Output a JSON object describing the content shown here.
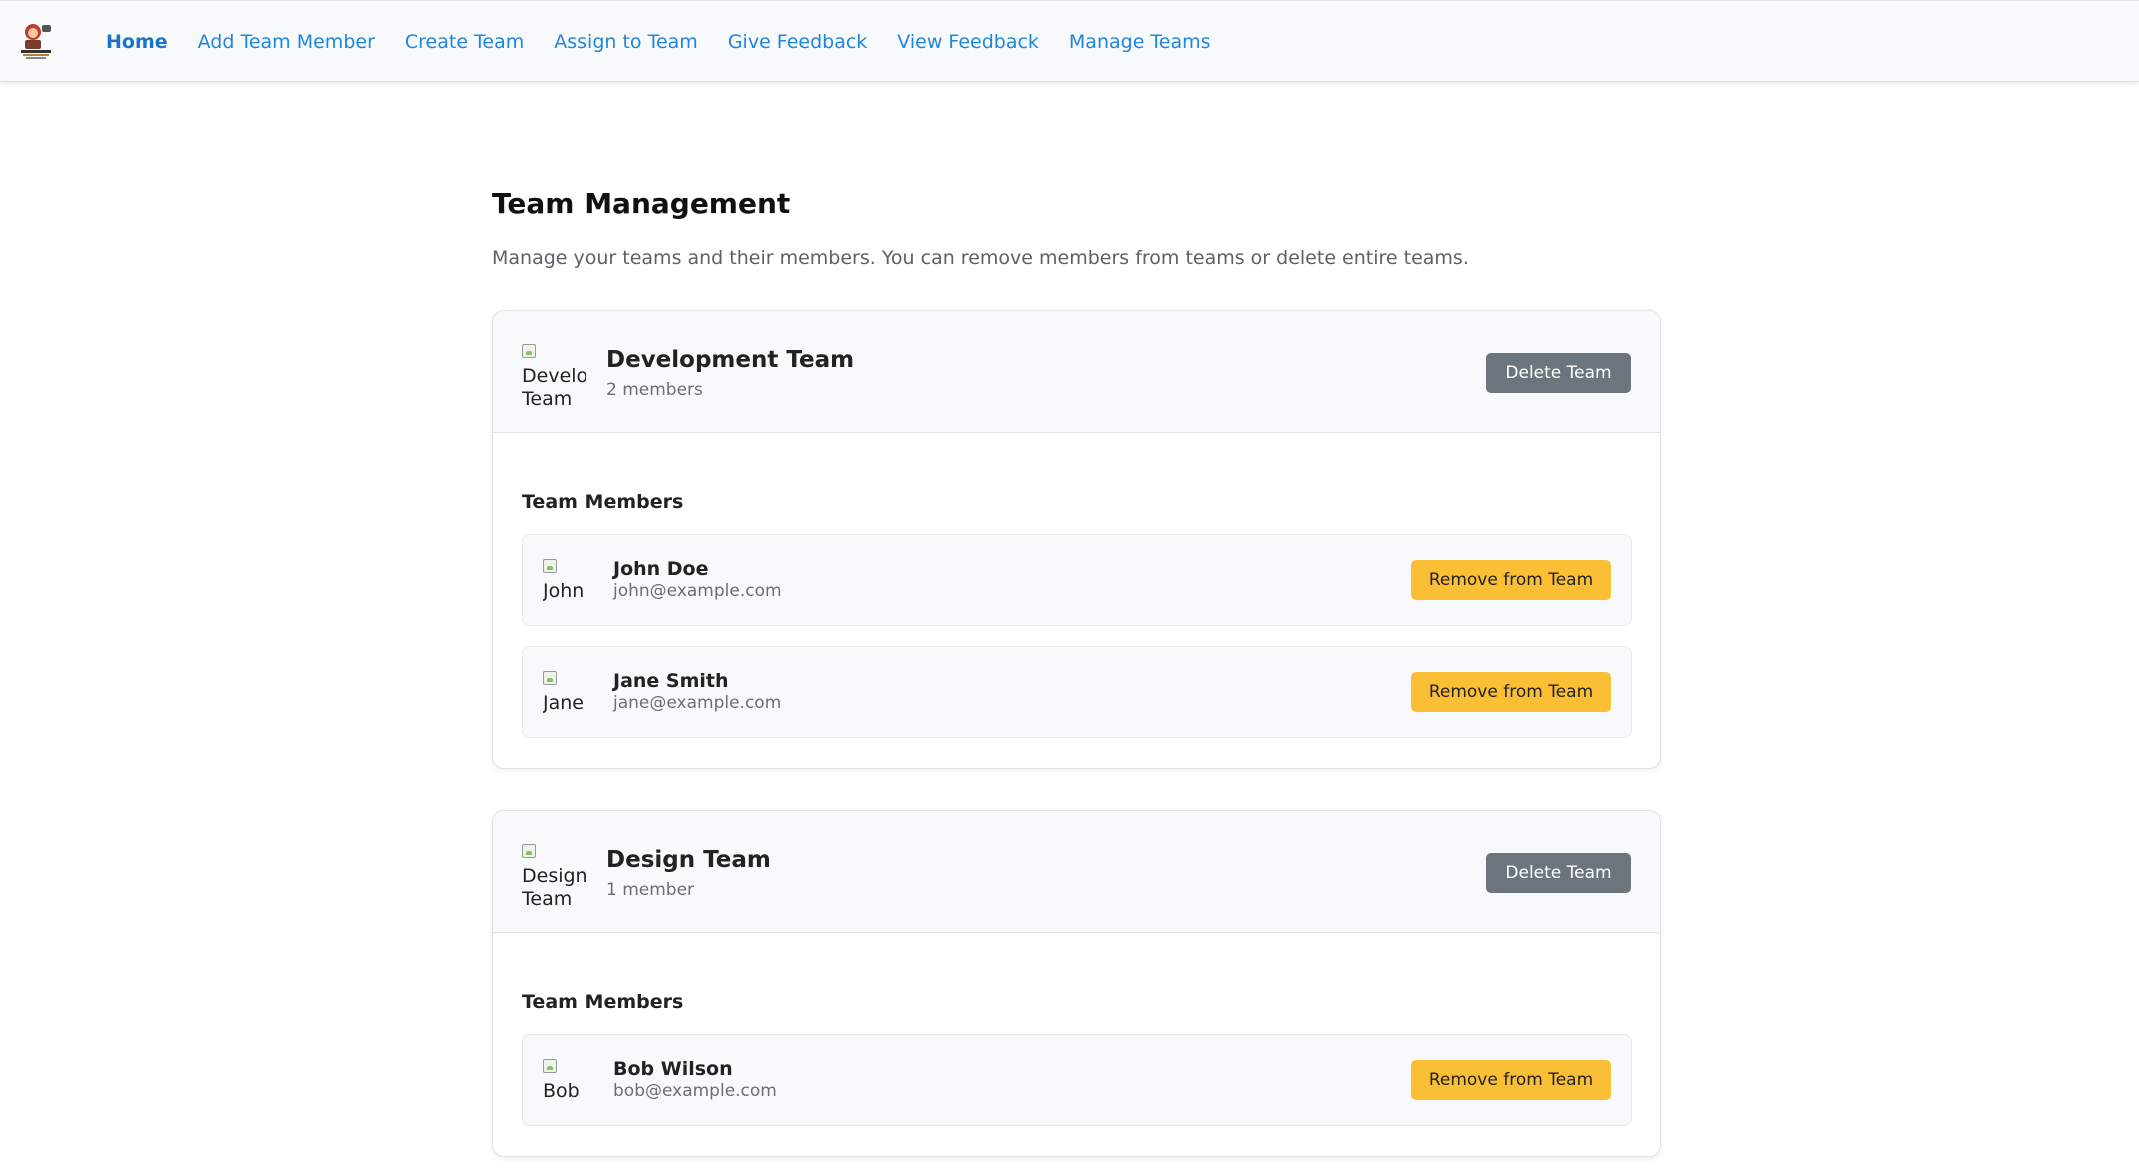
{
  "nav": {
    "logo_icon": "robot-mascot-logo",
    "links": [
      {
        "label": "Home",
        "active": true
      },
      {
        "label": "Add Team Member"
      },
      {
        "label": "Create Team"
      },
      {
        "label": "Assign to Team"
      },
      {
        "label": "Give Feedback"
      },
      {
        "label": "View Feedback"
      },
      {
        "label": "Manage Teams"
      }
    ]
  },
  "page": {
    "title": "Team Management",
    "description": "Manage your teams and their members. You can remove members from teams or delete entire teams."
  },
  "teams": [
    {
      "image_alt": "Develo Team",
      "name": "Development Team",
      "count": "2 members",
      "delete_label": "Delete Team",
      "members_title": "Team Members",
      "members": [
        {
          "image_alt": "John",
          "name": "John Doe",
          "email": "john@example.com",
          "remove_label": "Remove from Team"
        },
        {
          "image_alt": "Jane",
          "name": "Jane Smith",
          "email": "jane@example.com",
          "remove_label": "Remove from Team"
        }
      ]
    },
    {
      "image_alt": "Design Team",
      "name": "Design Team",
      "count": "1 member",
      "delete_label": "Delete Team",
      "members_title": "Team Members",
      "members": [
        {
          "image_alt": "Bob",
          "name": "Bob Wilson",
          "email": "bob@example.com",
          "remove_label": "Remove from Team"
        }
      ]
    }
  ],
  "colors": {
    "nav_link": "#1f86e0",
    "delete_button": "#6c757d",
    "remove_button": "#fbbf35"
  }
}
